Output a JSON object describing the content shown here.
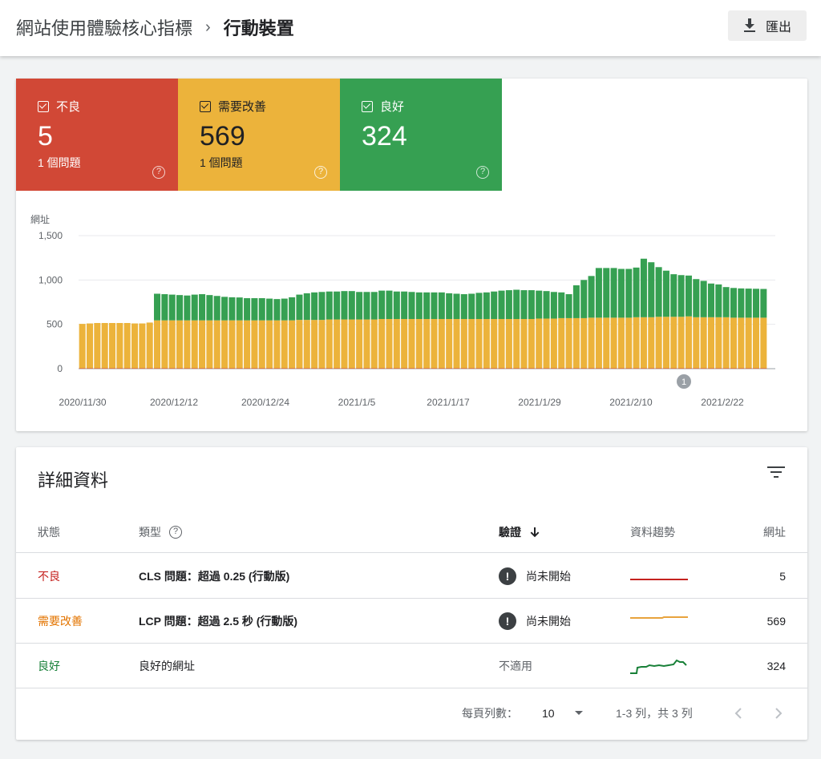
{
  "header": {
    "breadcrumb_parent": "網站使用體驗核心指標",
    "breadcrumb_current": "行動裝置",
    "export_label": "匯出"
  },
  "summary": {
    "poor": {
      "label": "不良",
      "count": "5",
      "issues": "1 個問題",
      "color": "#d14836"
    },
    "needs_improvement": {
      "label": "需要改善",
      "count": "569",
      "issues": "1 個問題",
      "color": "#ecb33b"
    },
    "good": {
      "label": "良好",
      "count": "324",
      "issues": "",
      "color": "#36a052"
    }
  },
  "chart_data": {
    "type": "bar",
    "stacked": true,
    "ylabel": "網址",
    "ylim": [
      0,
      1500
    ],
    "yticks": [
      "1,500",
      "1,000",
      "500",
      "0"
    ],
    "xtick_labels": [
      "2020/11/30",
      "2020/12/12",
      "2020/12/24",
      "2021/1/5",
      "2021/1/17",
      "2021/1/29",
      "2021/2/10",
      "2021/2/22"
    ],
    "annotation": "1",
    "grid": true,
    "series": [
      {
        "color": "#d14836",
        "values": [
          5,
          5,
          5,
          5,
          5,
          5,
          5,
          5,
          5,
          5,
          5,
          5,
          5,
          5,
          5,
          5,
          5,
          5,
          5,
          5,
          5,
          5,
          5,
          5,
          5,
          5,
          5,
          5,
          5,
          5,
          5,
          5,
          5,
          5,
          5,
          5,
          5,
          5,
          5,
          5,
          5,
          5,
          5,
          5,
          5,
          5,
          5,
          5,
          5,
          5,
          5,
          5,
          5,
          5,
          5,
          5,
          5,
          5,
          5,
          5,
          5,
          5,
          5,
          5,
          5,
          5,
          5,
          5,
          5,
          5,
          5,
          5,
          5,
          5,
          5,
          5,
          5,
          5,
          5,
          5,
          5,
          5,
          5,
          5,
          5,
          5,
          5,
          5,
          5,
          5,
          5,
          5
        ]
      },
      {
        "color": "#ecb33b",
        "values": [
          500,
          505,
          510,
          510,
          510,
          510,
          510,
          505,
          505,
          515,
          540,
          540,
          540,
          540,
          540,
          540,
          540,
          540,
          540,
          540,
          540,
          540,
          540,
          540,
          540,
          540,
          540,
          540,
          540,
          545,
          545,
          545,
          545,
          550,
          550,
          550,
          550,
          550,
          550,
          550,
          555,
          555,
          555,
          555,
          555,
          555,
          555,
          555,
          555,
          555,
          555,
          555,
          555,
          555,
          555,
          555,
          555,
          555,
          555,
          555,
          555,
          560,
          560,
          560,
          565,
          565,
          565,
          565,
          570,
          570,
          570,
          570,
          570,
          570,
          575,
          575,
          575,
          580,
          580,
          580,
          580,
          585,
          575,
          575,
          575,
          575,
          575,
          570,
          570,
          570,
          570,
          570
        ]
      },
      {
        "color": "#36a052",
        "values": [
          0,
          0,
          0,
          0,
          0,
          0,
          0,
          0,
          0,
          0,
          300,
          295,
          290,
          285,
          280,
          290,
          295,
          285,
          275,
          265,
          260,
          258,
          250,
          250,
          250,
          245,
          240,
          245,
          260,
          285,
          300,
          310,
          315,
          315,
          315,
          320,
          320,
          310,
          310,
          310,
          320,
          320,
          310,
          310,
          305,
          300,
          300,
          300,
          300,
          290,
          285,
          280,
          285,
          295,
          300,
          310,
          320,
          325,
          330,
          325,
          325,
          315,
          310,
          300,
          290,
          270,
          370,
          430,
          470,
          560,
          560,
          560,
          550,
          550,
          560,
          660,
          620,
          560,
          520,
          480,
          470,
          460,
          430,
          410,
          380,
          370,
          340,
          335,
          330,
          328,
          326,
          324
        ]
      }
    ]
  },
  "details": {
    "title": "詳細資料",
    "columns": {
      "status": "狀態",
      "type": "類型",
      "validation": "驗證",
      "trend": "資料趨勢",
      "urls": "網址"
    },
    "rows": [
      {
        "status": "不良",
        "type": "CLS 問題：超過 0.25 (行動版)",
        "validation": "尚未開始",
        "urls": "5",
        "trend_color": "#c5221f"
      },
      {
        "status": "需要改善",
        "type": "LCP 問題：超過 2.5 秒 (行動版)",
        "validation": "尚未開始",
        "urls": "569",
        "trend_color": "#e8a33d"
      },
      {
        "status": "良好",
        "type": "良好的網址",
        "validation": "不適用",
        "urls": "324",
        "trend_color": "#188038"
      }
    ],
    "pager": {
      "rows_per_page_label": "每頁列數：",
      "rows_per_page": "10",
      "range": "1-3 列，共 3 列"
    }
  }
}
